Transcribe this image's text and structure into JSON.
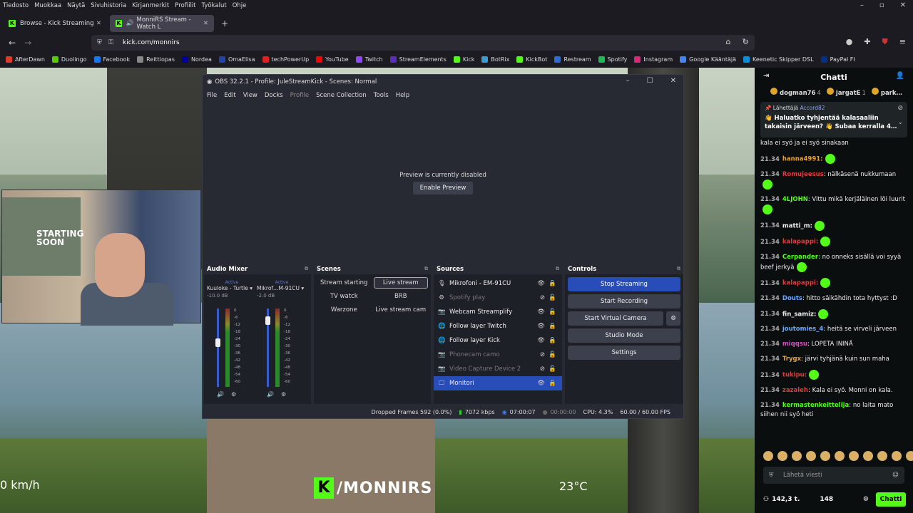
{
  "menubar": [
    "Tiedosto",
    "Muokkaa",
    "Näytä",
    "Sivuhistoria",
    "Kirjanmerkit",
    "Profiilit",
    "Työkalut",
    "Ohje"
  ],
  "tabs": [
    {
      "label": "Browse - Kick Streaming"
    },
    {
      "label": "MonniRS Stream - Watch L"
    }
  ],
  "new_tab": "+",
  "url": "kick.com/monnirs",
  "bookmarks": [
    {
      "label": "AfterDawn",
      "color": "#e03a2a"
    },
    {
      "label": "Duolingo",
      "color": "#58cc02"
    },
    {
      "label": "Facebook",
      "color": "#1877f2"
    },
    {
      "label": "Reittiopas",
      "color": "#888888"
    },
    {
      "label": "Nordea",
      "color": "#0000a0"
    },
    {
      "label": "OmaElisa",
      "color": "#2244aa"
    },
    {
      "label": "techPowerUp",
      "color": "#e02020"
    },
    {
      "label": "YouTube",
      "color": "#ff0000"
    },
    {
      "label": "Twitch",
      "color": "#9146ff"
    },
    {
      "label": "StreamElements",
      "color": "#5b2dbb"
    },
    {
      "label": "Kick",
      "color": "#53fc18"
    },
    {
      "label": "BotRix",
      "color": "#3a9bd5"
    },
    {
      "label": "KickBot",
      "color": "#53fc18"
    },
    {
      "label": "Restream",
      "color": "#2c6bd9"
    },
    {
      "label": "Spotify",
      "color": "#1db954"
    },
    {
      "label": "Instagram",
      "color": "#d62976"
    },
    {
      "label": "Google Kääntäjä",
      "color": "#4285f4"
    },
    {
      "label": "Keenetic Skipper DSL",
      "color": "#0a8fd8"
    },
    {
      "label": "PayPal FI",
      "color": "#003087"
    }
  ],
  "video": {
    "speed": "0 km/h",
    "temp": "23°C",
    "brand": "/MONNIRS",
    "poster_text": "STARTING SOON"
  },
  "obs": {
    "title": "OBS 32.2.1 - Profile: JuleStreamKick - Scenes: Normal",
    "menu": [
      "File",
      "Edit",
      "View",
      "Docks",
      "Profile",
      "Scene Collection",
      "Tools",
      "Help"
    ],
    "preview_msg": "Preview is currently disabled",
    "enable_preview": "Enable Preview",
    "mixer": {
      "title": "Audio Mixer",
      "channels": [
        {
          "name": "Kuuloke - Turtle",
          "status": "Active",
          "db": "-10.0 dB",
          "level": 0.62
        },
        {
          "name": "Mikrof…M-91CU",
          "status": "Active",
          "db": "-2.0 dB",
          "level": 0.9
        }
      ],
      "scale": [
        "0",
        "-6",
        "-12",
        "-18",
        "-24",
        "-30",
        "-36",
        "-42",
        "-48",
        "-54",
        "-60"
      ]
    },
    "scenes": {
      "title": "Scenes",
      "items": [
        "Stream starting",
        "Live stream",
        "TV watck",
        "BRB",
        "Warzone",
        "Live stream cam"
      ],
      "selected": "Live stream"
    },
    "sources": {
      "title": "Sources",
      "items": [
        {
          "label": "Mikrofoni - EM-91CU",
          "icon": "mic-icon",
          "visible": true,
          "locked": true
        },
        {
          "label": "Spotify play",
          "icon": "gear-icon",
          "visible": false,
          "locked": false
        },
        {
          "label": "Webcam Streamplify",
          "icon": "camera-icon",
          "visible": true,
          "locked": false
        },
        {
          "label": "Follow layer Twitch",
          "icon": "globe-icon",
          "visible": true,
          "locked": true
        },
        {
          "label": "Follow layer Kick",
          "icon": "globe-icon",
          "visible": true,
          "locked": true
        },
        {
          "label": "Phonecam camo",
          "icon": "camera-icon",
          "visible": false,
          "locked": false
        },
        {
          "label": "Video Capture Device 2",
          "icon": "camera-icon",
          "visible": false,
          "locked": false
        },
        {
          "label": "Monitori",
          "icon": "monitor-icon",
          "visible": true,
          "locked": true
        }
      ],
      "selected": "Monitori"
    },
    "controls": {
      "title": "Controls",
      "buttons": [
        "Stop Streaming",
        "Start Recording",
        "Start Virtual Camera",
        "Studio Mode",
        "Settings"
      ]
    },
    "status": {
      "dropped": "Dropped Frames 592 (0.0%)",
      "kbps": "7072 kbps",
      "stream_time": "07:00:07",
      "rec_time": "00:00:00",
      "cpu": "CPU: 4.3%",
      "fps": "60.00 / 60.00 FPS"
    }
  },
  "chat": {
    "title": "Chatti",
    "top": [
      {
        "name": "dogman76",
        "count": "4"
      },
      {
        "name": "jargatE",
        "count": "1"
      },
      {
        "name": "park…",
        "count": ""
      }
    ],
    "pinned": {
      "label": "Lähettäjä",
      "user": "Accord82",
      "text": "👋 Haluatko tyhjentää kalasaaliin takaisin järveen? 👋 Subaa kerralla 4…"
    },
    "messages": [
      {
        "time": "",
        "user": "",
        "color": "#eeeeee",
        "text": "kala ei syö ja ei syö sinakaan",
        "emote": false
      },
      {
        "time": "21.34",
        "user": "hanna4991:",
        "color": "#f0a030",
        "text": "",
        "emote": true
      },
      {
        "time": "21.34",
        "user": "Romujeesus",
        "color": "#e03a3a",
        "text": ": nälkäsenä nukkumaan",
        "emote": true
      },
      {
        "time": "21.34",
        "user": "4LJOHN",
        "color": "#53fc18",
        "text": ": Vittu mikä kerjäläinen löi luurit",
        "emote": true
      },
      {
        "time": "21.34",
        "user": "matti_m:",
        "color": "#eeeeee",
        "text": "",
        "emote": true
      },
      {
        "time": "21.34",
        "user": "kalapappi:",
        "color": "#e03a3a",
        "text": "",
        "emote": true
      },
      {
        "time": "21.34",
        "user": "Cerpander",
        "color": "#53fc18",
        "text": ": no onneks sisällä voi syyä beef jerkyä",
        "emote": true
      },
      {
        "time": "21.34",
        "user": "kalapappi:",
        "color": "#e03a3a",
        "text": "",
        "emote": true
      },
      {
        "time": "21.34",
        "user": "Douts",
        "color": "#6aa8ff",
        "text": ": hitto säikähdin tota hyttyst :D",
        "emote": false
      },
      {
        "time": "21.34",
        "user": "fin_samiz:",
        "color": "#eeeeee",
        "text": "",
        "emote": true
      },
      {
        "time": "21.34",
        "user": "joutomies_4",
        "color": "#6aa8ff",
        "text": ": heitä se virveli järveen",
        "emote": false
      },
      {
        "time": "21.34",
        "user": "miqqsu",
        "color": "#d050c0",
        "text": ": LOPETA ININÄ",
        "emote": false
      },
      {
        "time": "21.34",
        "user": "Trygx",
        "color": "#f0a030",
        "text": ": järvi tyhjänä kuin sun maha",
        "emote": false
      },
      {
        "time": "21.34",
        "user": "tukipu:",
        "color": "#e03a3a",
        "text": "",
        "emote": true
      },
      {
        "time": "21.34",
        "user": "zazaleh",
        "color": "#e03a3a",
        "text": ": Kala ei syö. Monni on kala.",
        "emote": false
      },
      {
        "time": "21.34",
        "user": "kermastenkeittelija",
        "color": "#53fc18",
        "text": ": no laita mato siihen nii syö heti",
        "emote": false
      }
    ],
    "input_placeholder": "Lähetä viesti",
    "viewers": "142,3 t.",
    "count": "148",
    "send": "Chatti"
  }
}
